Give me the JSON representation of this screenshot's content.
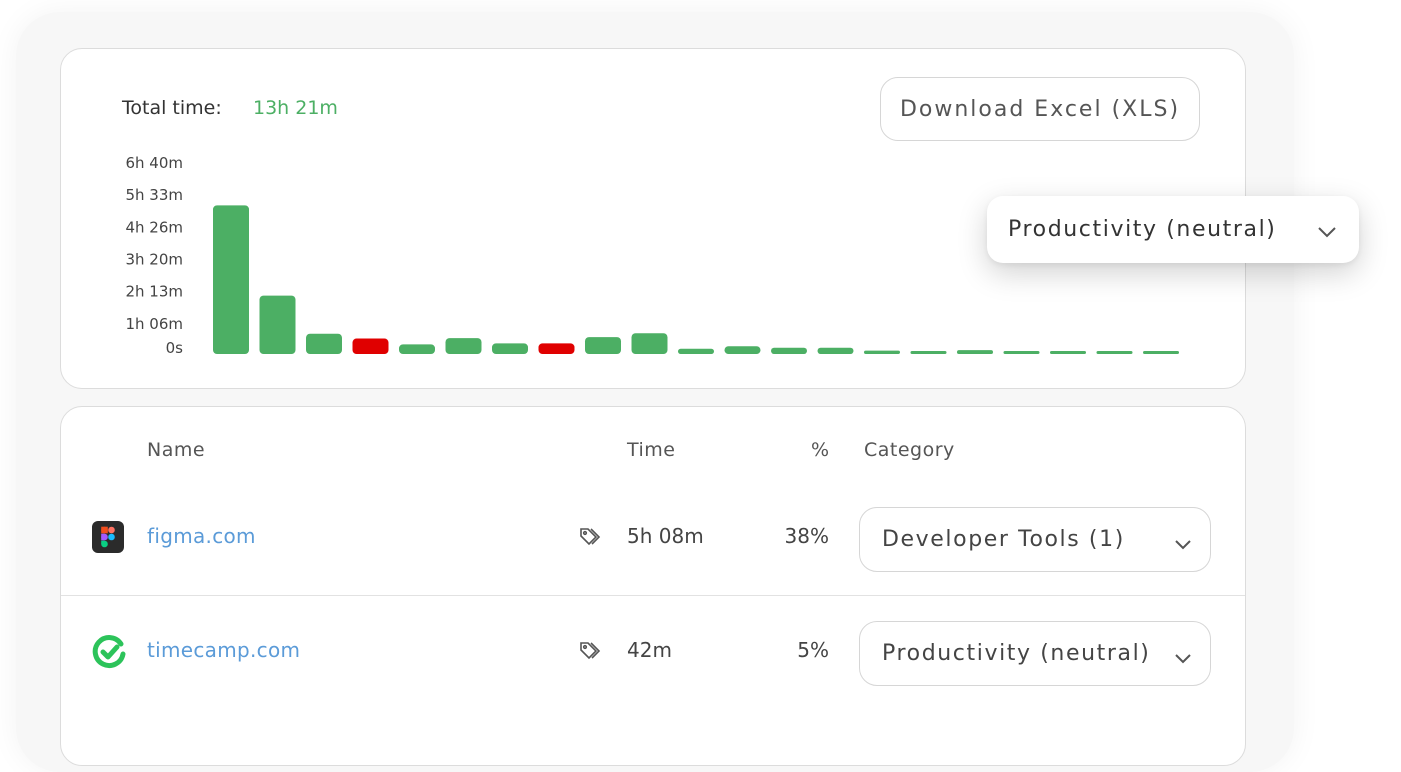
{
  "summary": {
    "total_label": "Total time:",
    "total_value": "13h 21m"
  },
  "toolbar": {
    "download_label": "Download Excel (XLS)"
  },
  "category_filter": {
    "selected": "Productivity (neutral)"
  },
  "table": {
    "headers": {
      "name": "Name",
      "time": "Time",
      "percent": "%",
      "category": "Category"
    },
    "rows": [
      {
        "name": "figma.com",
        "time": "5h 08m",
        "percent": "38%",
        "category": "Developer Tools (1)",
        "icon": "figma-icon"
      },
      {
        "name": "timecamp.com",
        "time": "42m",
        "percent": "5%",
        "category": "Productivity (neutral)",
        "icon": "timecamp-icon"
      }
    ]
  },
  "colors": {
    "productive": "#4caf64",
    "unproductive": "#e00000",
    "link": "#5b9bd8"
  },
  "chart_data": {
    "type": "bar",
    "y_tick_labels": [
      "6h 40m",
      "5h 33m",
      "4h 26m",
      "3h 20m",
      "2h 13m",
      "1h 06m",
      "0s"
    ],
    "ylim_minutes": [
      0,
      400
    ],
    "values_minutes": [
      308,
      121,
      42,
      32,
      20,
      33,
      22,
      22,
      35,
      43,
      11,
      16,
      13,
      13,
      7,
      3,
      8,
      3,
      3,
      3,
      3
    ],
    "bar_status": [
      "productive",
      "productive",
      "productive",
      "unproductive",
      "productive",
      "productive",
      "productive",
      "unproductive",
      "productive",
      "productive",
      "productive",
      "productive",
      "productive",
      "productive",
      "productive",
      "productive",
      "productive",
      "productive",
      "productive",
      "productive",
      "productive"
    ]
  }
}
